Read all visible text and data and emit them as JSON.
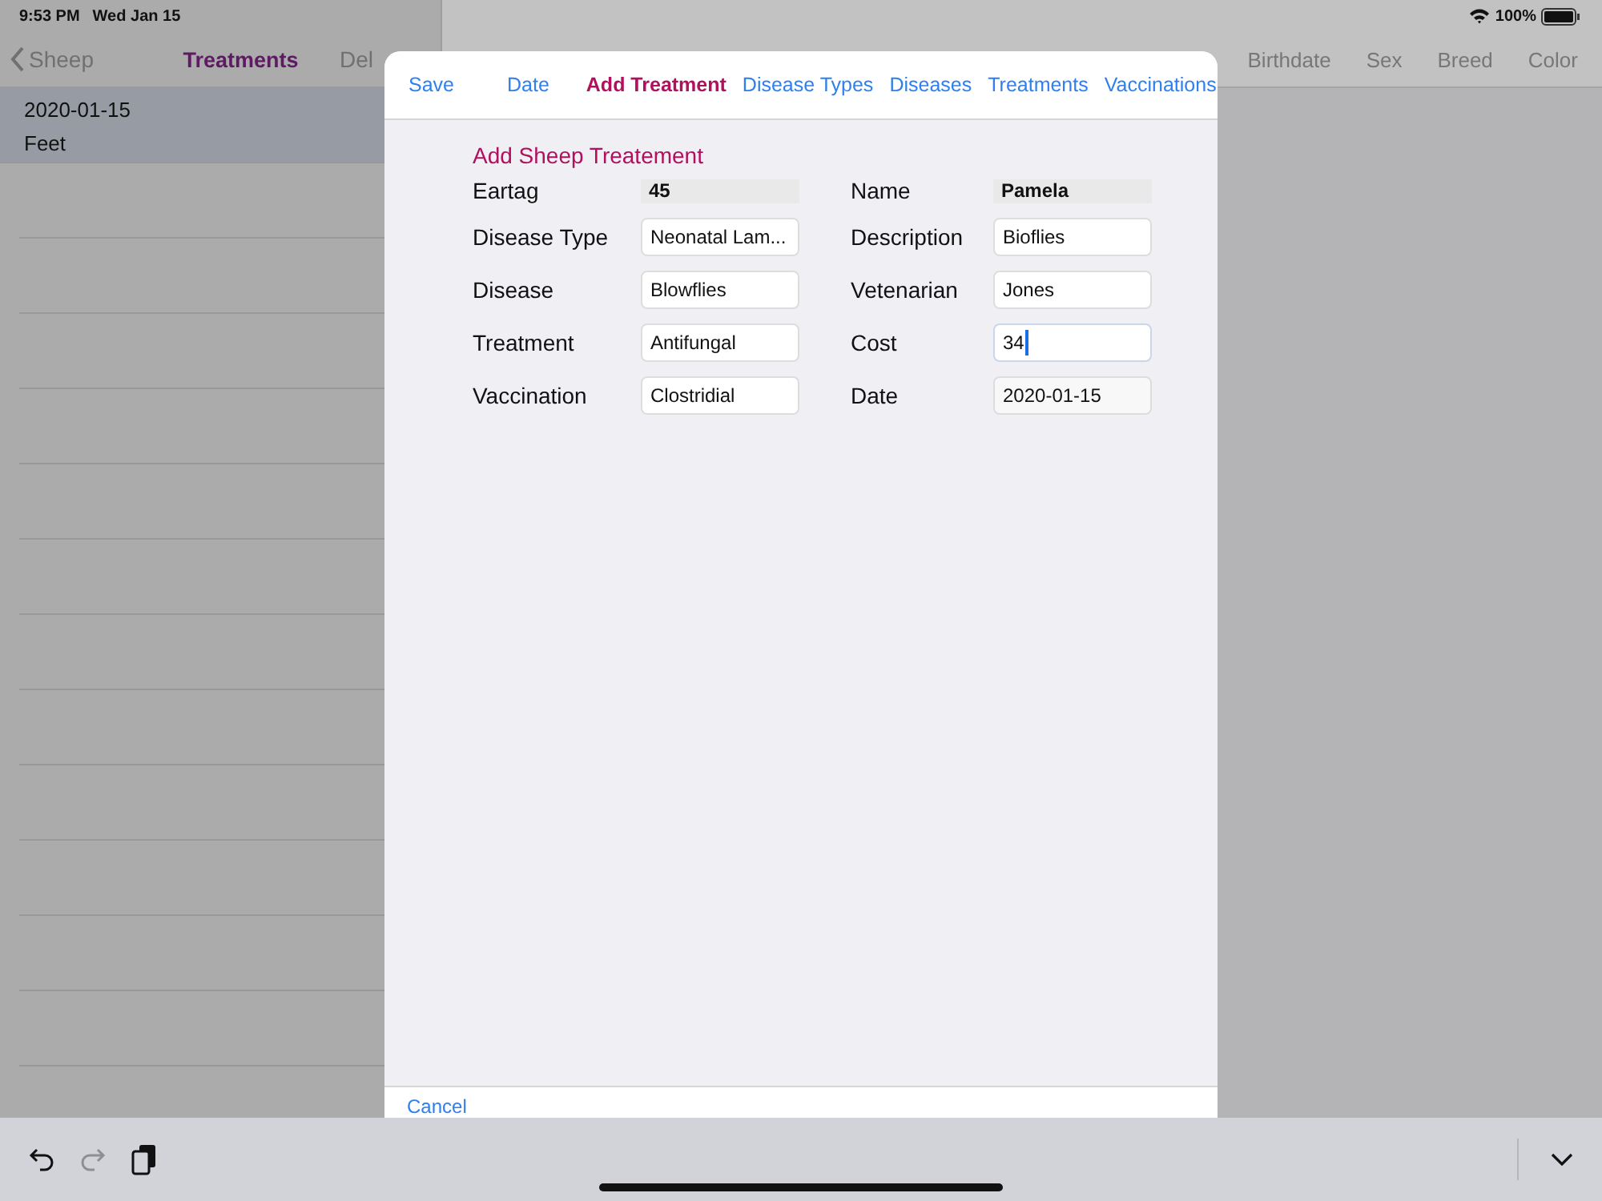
{
  "status_bar": {
    "time": "9:53 PM",
    "date": "Wed Jan 15",
    "battery": "100%"
  },
  "master": {
    "back": "Sheep",
    "title": "Treatments",
    "action": "Del",
    "rows": [
      {
        "date": "2020-01-15",
        "area": "Feet",
        "selected": true
      }
    ]
  },
  "detail_header": {
    "columns": [
      "Birthdate",
      "Sex",
      "Breed",
      "Color"
    ]
  },
  "modal": {
    "tabs": [
      {
        "label": "Save",
        "selected": false
      },
      {
        "label": "Date",
        "selected": false
      },
      {
        "label": "Add Treatment",
        "selected": true
      },
      {
        "label": "Disease Types",
        "selected": false
      },
      {
        "label": "Diseases",
        "selected": false
      },
      {
        "label": "Treatments",
        "selected": false
      },
      {
        "label": "Vaccinations",
        "selected": false
      }
    ],
    "title": "Add Sheep Treatement",
    "fields": [
      {
        "label": "Eartag",
        "value": "45",
        "kind": "readonly",
        "focused": false
      },
      {
        "label": "Name",
        "value": "Pamela",
        "kind": "readonly",
        "focused": false
      },
      {
        "label": "Disease Type",
        "value": "Neonatal Lam...",
        "kind": "text",
        "focused": false
      },
      {
        "label": "Description",
        "value": "Bioflies",
        "kind": "text",
        "focused": false
      },
      {
        "label": "Disease",
        "value": "Blowflies",
        "kind": "text",
        "focused": false
      },
      {
        "label": "Vetenarian",
        "value": "Jones",
        "kind": "text",
        "focused": false
      },
      {
        "label": "Treatment",
        "value": "Antifungal",
        "kind": "text",
        "focused": false
      },
      {
        "label": "Cost",
        "value": "34",
        "kind": "text",
        "focused": true
      },
      {
        "label": "Vaccination",
        "value": "Clostridial",
        "kind": "text",
        "focused": false
      },
      {
        "label": "Date",
        "value": "2020-01-15",
        "kind": "date",
        "focused": false
      }
    ],
    "cancel": "Cancel"
  },
  "keyboard_bar": {
    "redo_disabled": true
  }
}
